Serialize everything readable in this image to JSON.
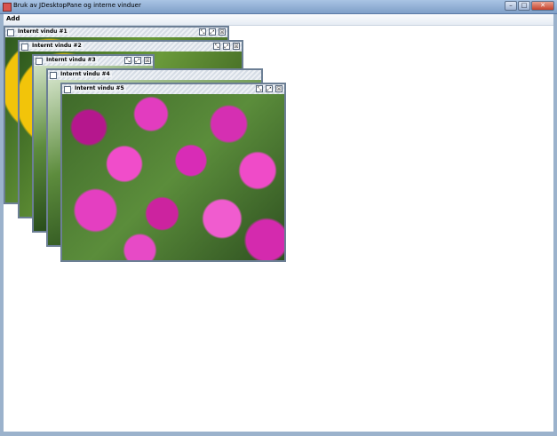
{
  "window": {
    "title": "Bruk av JDesktopPane og interne vinduer",
    "minimize_glyph": "–",
    "maximize_glyph": "□",
    "close_glyph": "✕"
  },
  "menubar": {
    "items": [
      {
        "label": "Add"
      }
    ]
  },
  "internal_frames": [
    {
      "title": "Internt vindu #1",
      "image": "sunflower-photo"
    },
    {
      "title": "Internt vindu #2",
      "image": "sunflower-photo"
    },
    {
      "title": "Internt vindu #3",
      "image": "green-leaves-photo"
    },
    {
      "title": "Internt vindu #4",
      "image": "green-leaves-photo"
    },
    {
      "title": "Internt vindu #5",
      "image": "petunia-photo"
    }
  ],
  "frame_controls": {
    "iconify_glyph": "⤡",
    "maximize_glyph": "⤢",
    "close_glyph": "☒"
  },
  "colors": {
    "os_titlebar": "#7f9fc8",
    "desktop": "#ffffff",
    "frame_border": "#6c7f95"
  }
}
